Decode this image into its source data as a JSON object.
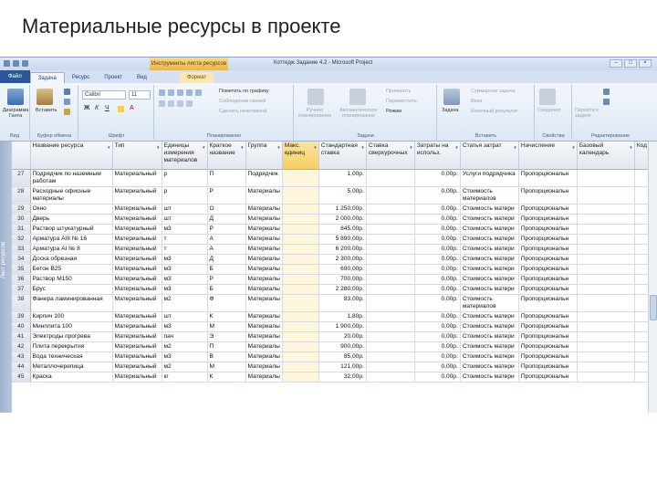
{
  "slide_title": "Материальные ресурсы в проекте",
  "window": {
    "contextual_tab": "Инструменты листа ресурсов",
    "title": "Коттедж Задание 4.2  -  Microsoft Project"
  },
  "tabs": [
    {
      "label": "Файл"
    },
    {
      "label": "Задача"
    },
    {
      "label": "Ресурс"
    },
    {
      "label": "Проект"
    },
    {
      "label": "Вид"
    },
    {
      "label": "Формат"
    }
  ],
  "ribbon": {
    "view": {
      "button": "Диаграмма Ганта",
      "group": "Вид"
    },
    "clipboard": {
      "paste": "Вставить",
      "group": "Буфер обмена"
    },
    "font": {
      "name": "Calibri",
      "size": "11",
      "group": "Шрифт"
    },
    "schedule": {
      "items": [
        "Пометить по графику",
        "Соблюдение связей",
        "Сделать неактивной"
      ],
      "group": "Планирование"
    },
    "tasks": {
      "manual": "Ручное планирование",
      "auto": "Автоматическое планирование",
      "items": [
        "Проверить",
        "Переместить",
        "Режим"
      ],
      "group": "Задачи"
    },
    "insert": {
      "task": "Задача",
      "items": [
        "Суммарная задача",
        "Веха",
        "Конечный результат"
      ],
      "group": "Вставить"
    },
    "properties": {
      "info": "Сведения",
      "group": "Свойства"
    },
    "editing": {
      "goto": "Перейти к задаче",
      "group": "Редактирование"
    }
  },
  "sidebar_label": "Лист ресурсов",
  "columns": [
    "",
    "Название ресурса",
    "Тип",
    "Единицы измерения материалов",
    "Краткое название",
    "Группа",
    "Макс. единиц",
    "Стандартная ставка",
    "Ставка сверхурочных",
    "Затраты на использ.",
    "Статья затрат",
    "Начисление",
    "Базовый календарь",
    "Код"
  ],
  "rows": [
    [
      "27",
      "Подрядчик по наземным работам",
      "Материальный",
      "р",
      "П",
      "Подрядчик",
      "",
      "1,00р.",
      "",
      "0,00р.",
      "Услуги подрядчика",
      "Пропорциональн",
      "",
      ""
    ],
    [
      "28",
      "Расходные офисные материалы",
      "Материальный",
      "р",
      "Р",
      "Материалы",
      "",
      "5,00р.",
      "",
      "0,00р.",
      "Стоимость материалов",
      "Пропорциональн",
      "",
      ""
    ],
    [
      "29",
      "Окно",
      "Материальный",
      "шт",
      "О",
      "Материалы",
      "",
      "1 250,00р.",
      "",
      "0,00р.",
      "Стоимость матери",
      "Пропорциональн",
      "",
      ""
    ],
    [
      "30",
      "Дверь",
      "Материальный",
      "шт",
      "Д",
      "Материалы",
      "",
      "2 000,00р.",
      "",
      "0,00р.",
      "Стоимость матери",
      "Пропорциональн",
      "",
      ""
    ],
    [
      "31",
      "Раствор штукатурный",
      "Материальный",
      "м3",
      "Р",
      "Материалы",
      "",
      "845,00р.",
      "",
      "0,00р.",
      "Стоимость матери",
      "Пропорциональн",
      "",
      ""
    ],
    [
      "32",
      "Арматура AIII № 16",
      "Материальный",
      "т",
      "А",
      "Материалы",
      "",
      "5 890,00р.",
      "",
      "0,00р.",
      "Стоимость матери",
      "Пропорциональн",
      "",
      ""
    ],
    [
      "33",
      "Арматура AI № 8",
      "Материальный",
      "т",
      "А",
      "Материалы",
      "",
      "6 200,00р.",
      "",
      "0,00р.",
      "Стоимость матери",
      "Пропорциональн",
      "",
      ""
    ],
    [
      "34",
      "Доска обрезная",
      "Материальный",
      "м3",
      "Д",
      "Материалы",
      "",
      "2 300,00р.",
      "",
      "0,00р.",
      "Стоимость матери",
      "Пропорциональн",
      "",
      ""
    ],
    [
      "35",
      "Бетон B25",
      "Материальный",
      "м3",
      "Б",
      "Материалы",
      "",
      "690,00р.",
      "",
      "0,00р.",
      "Стоимость матери",
      "Пропорциональн",
      "",
      ""
    ],
    [
      "36",
      "Раствор M150",
      "Материальный",
      "м3",
      "Р",
      "Материалы",
      "",
      "700,00р.",
      "",
      "0,00р.",
      "Стоимость матери",
      "Пропорциональн",
      "",
      ""
    ],
    [
      "37",
      "Брус",
      "Материальный",
      "м3",
      "Б",
      "Материалы",
      "",
      "2 280,00р.",
      "",
      "0,00р.",
      "Стоимость матери",
      "Пропорциональн",
      "",
      ""
    ],
    [
      "38",
      "Фанера ламинированная",
      "Материальный",
      "м2",
      "Ф",
      "Материалы",
      "",
      "83,00р.",
      "",
      "0,00р.",
      "Стоимость материалов",
      "Пропорциональн",
      "",
      ""
    ],
    [
      "39",
      "Кирпич 100",
      "Материальный",
      "шт",
      "К",
      "Материалы",
      "",
      "1,80р.",
      "",
      "0,00р.",
      "Стоимость матери",
      "Пропорциональн",
      "",
      ""
    ],
    [
      "40",
      "Минплита 100",
      "Материальный",
      "м3",
      "М",
      "Материалы",
      "",
      "1 900,00р.",
      "",
      "0,00р.",
      "Стоимость матери",
      "Пропорциональн",
      "",
      ""
    ],
    [
      "41",
      "Электроды прогрева",
      "Материальный",
      "пач",
      "Э",
      "Материалы",
      "",
      "20,00р.",
      "",
      "0,00р.",
      "Стоимость матери",
      "Пропорциональн",
      "",
      ""
    ],
    [
      "42",
      "Плита перекрытия",
      "Материальный",
      "м2",
      "П",
      "Материалы",
      "",
      "900,00р.",
      "",
      "0,00р.",
      "Стоимость матери",
      "Пропорциональн",
      "",
      ""
    ],
    [
      "43",
      "Вода техническая",
      "Материальный",
      "м3",
      "В",
      "Материалы",
      "",
      "85,00р.",
      "",
      "0,00р.",
      "Стоимость матери",
      "Пропорциональн",
      "",
      ""
    ],
    [
      "44",
      "Металлочерепица",
      "Материальный",
      "м2",
      "М",
      "Материалы",
      "",
      "121,00р.",
      "",
      "0,00р.",
      "Стоимость матери",
      "Пропорциональн",
      "",
      ""
    ],
    [
      "45",
      "Краска",
      "Материальный",
      "кг",
      "К",
      "Материалы",
      "",
      "32,00р.",
      "",
      "0,00р.",
      "Стоимость матери",
      "Пропорциональн",
      "",
      ""
    ]
  ],
  "colors": {
    "accent": "#2b5797",
    "highlight_col": "#f6cd5e",
    "ribbon": "#dde8f5"
  }
}
